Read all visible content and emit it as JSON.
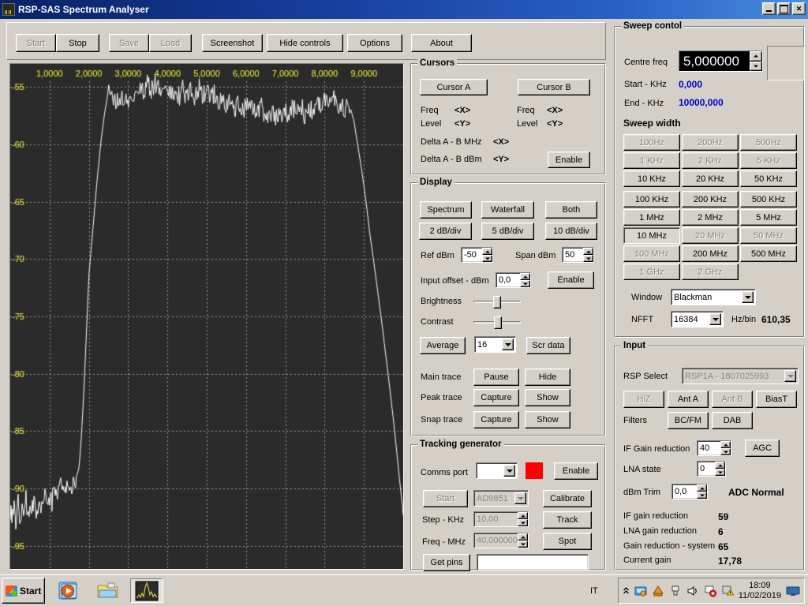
{
  "window": {
    "title": "RSP-SAS Spectrum Analyser",
    "icon": "spectrum-app-icon",
    "buttons": {
      "minimize": "_",
      "maximize": "□",
      "close": "✕"
    }
  },
  "toolbar": {
    "buttons": [
      {
        "label": "Start",
        "disabled": true,
        "name": "start-button"
      },
      {
        "label": "Stop",
        "disabled": false,
        "name": "stop-button"
      },
      {
        "label": "Save",
        "disabled": true,
        "name": "save-button"
      },
      {
        "label": "Load",
        "disabled": true,
        "name": "load-button"
      },
      {
        "label": "Screenshot",
        "disabled": false,
        "name": "screenshot-button"
      },
      {
        "label": "Hide controls",
        "disabled": false,
        "name": "hide-controls-button"
      },
      {
        "label": "Options",
        "disabled": false,
        "name": "options-button"
      },
      {
        "label": "About",
        "disabled": false,
        "name": "about-button"
      }
    ]
  },
  "cursors": {
    "legend": "Cursors",
    "cursor_a_button": "Cursor A",
    "cursor_b_button": "Cursor B",
    "a_freq_label": "Freq",
    "a_freq_value": "<X>",
    "a_level_label": "Level",
    "a_level_value": "<Y>",
    "b_freq_label": "Freq",
    "b_freq_value": "<X>",
    "b_level_label": "Level",
    "b_level_value": "<Y>",
    "delta_mhz_label": "Delta A - B MHz",
    "delta_mhz_value": "<X>",
    "delta_dbm_label": "Delta A - B dBm",
    "delta_dbm_value": "<Y>",
    "enable_button": "Enable"
  },
  "display": {
    "legend": "Display",
    "mode_buttons": [
      {
        "label": "Spectrum",
        "name": "spectrum-mode-button"
      },
      {
        "label": "Waterfall",
        "name": "waterfall-mode-button"
      },
      {
        "label": "Both",
        "name": "both-mode-button"
      }
    ],
    "scale_buttons": [
      {
        "label": "2 dB/div",
        "name": "scale-2db-button"
      },
      {
        "label": "5 dB/div",
        "name": "scale-5db-button"
      },
      {
        "label": "10 dB/div",
        "name": "scale-10db-button"
      }
    ],
    "ref_dbm_label": "Ref dBm",
    "ref_dbm_value": "-50",
    "span_dbm_label": "Span dBm",
    "span_dbm_value": "50",
    "input_offset_label": "Input offset - dBm",
    "input_offset_value": "0,0",
    "input_offset_enable": "Enable",
    "brightness_label": "Brightness",
    "contrast_label": "Contrast",
    "average_button": "Average",
    "average_value": "16",
    "scr_data_button": "Scr data",
    "main_trace_label": "Main trace",
    "main_trace_pause": "Pause",
    "main_trace_hide": "Hide",
    "peak_trace_label": "Peak trace",
    "peak_trace_capture": "Capture",
    "peak_trace_show": "Show",
    "snap_trace_label": "Snap trace",
    "snap_trace_capture": "Capture",
    "snap_trace_show": "Show"
  },
  "tracking_generator": {
    "legend": "Tracking generator",
    "comms_port_label": "Comms port",
    "comms_port_value": "",
    "status_color": "#ff0000",
    "enable_button": "Enable",
    "start_button": "Start",
    "chip_value": "AD9851",
    "calibrate_button": "Calibrate",
    "step_khz_label": "Step - KHz",
    "step_khz_value": "10,00",
    "track_button": "Track",
    "freq_mhz_label": "Freq - MHz",
    "freq_mhz_value": "40,000000",
    "spot_button": "Spot",
    "get_pins_button": "Get pins",
    "get_pins_value": ""
  },
  "sweep_control": {
    "legend": "Sweep contol",
    "centre_freq_label": "Centre freq",
    "centre_freq_value": "5,000000",
    "start_khz_label": "Start - KHz",
    "start_khz_value": "0,000",
    "end_khz_label": "End - KHz",
    "end_khz_value": "10000,000",
    "sweep_width_label": "Sweep width",
    "sweep_width_buttons": [
      {
        "label": "100Hz",
        "disabled": true,
        "selected": false
      },
      {
        "label": "200Hz",
        "disabled": true,
        "selected": false
      },
      {
        "label": "500Hz",
        "disabled": true,
        "selected": false
      },
      {
        "label": "1 KHz",
        "disabled": true,
        "selected": false
      },
      {
        "label": "2 KHz",
        "disabled": true,
        "selected": false
      },
      {
        "label": "5 KHz",
        "disabled": true,
        "selected": false
      },
      {
        "label": "10 KHz",
        "disabled": false,
        "selected": false
      },
      {
        "label": "20 KHz",
        "disabled": false,
        "selected": false
      },
      {
        "label": "50 KHz",
        "disabled": false,
        "selected": false
      },
      {
        "label": "100 KHz",
        "disabled": false,
        "selected": false
      },
      {
        "label": "200 KHz",
        "disabled": false,
        "selected": false
      },
      {
        "label": "500 KHz",
        "disabled": false,
        "selected": false
      },
      {
        "label": "1 MHz",
        "disabled": false,
        "selected": false
      },
      {
        "label": "2 MHz",
        "disabled": false,
        "selected": false
      },
      {
        "label": "5 MHz",
        "disabled": false,
        "selected": false
      },
      {
        "label": "10 MHz",
        "disabled": false,
        "selected": true
      },
      {
        "label": "20 MHz",
        "disabled": true,
        "selected": false
      },
      {
        "label": "50 MHz",
        "disabled": true,
        "selected": false
      },
      {
        "label": "100 MHz",
        "disabled": true,
        "selected": false
      },
      {
        "label": "200 MHz",
        "disabled": false,
        "selected": false
      },
      {
        "label": "500 MHz",
        "disabled": false,
        "selected": false
      },
      {
        "label": "1 GHz",
        "disabled": true,
        "selected": false
      },
      {
        "label": "2 GHz",
        "disabled": true,
        "selected": false
      }
    ],
    "window_label": "Window",
    "window_value": "Blackman",
    "nfft_label": "NFFT",
    "nfft_value": "16384",
    "hz_bin_label": "Hz/bin",
    "hz_bin_value": "610,35"
  },
  "input": {
    "legend": "Input",
    "rsp_select_label": "RSP Select",
    "rsp_select_value": "RSP1A - 1807025993",
    "ant_buttons": [
      {
        "label": "HiZ",
        "disabled": true,
        "selected": false
      },
      {
        "label": "Ant A",
        "disabled": false,
        "selected": true
      },
      {
        "label": "Ant B",
        "disabled": true,
        "selected": false
      },
      {
        "label": "BiasT",
        "disabled": false,
        "selected": false
      }
    ],
    "filters_label": "Filters",
    "filter_buttons": [
      {
        "label": "BC/FM",
        "name": "filter-bcfm-button"
      },
      {
        "label": "DAB",
        "name": "filter-dab-button"
      }
    ],
    "if_gain_reduction_label": "IF Gain reduction",
    "if_gain_reduction_value": "40",
    "agc_button": "AGC",
    "lna_state_label": "LNA state",
    "lna_state_value": "0",
    "dbm_trim_label": "dBm Trim",
    "dbm_trim_value": "0,0",
    "adc_status": "ADC Normal",
    "readouts": [
      {
        "label": "IF gain reduction",
        "value": "59"
      },
      {
        "label": "LNA gain reduction",
        "value": "6"
      },
      {
        "label": "Gain reduction - system",
        "value": "65"
      },
      {
        "label": "Current gain",
        "value": "17,78"
      }
    ]
  },
  "taskbar": {
    "start_label": "Start",
    "items": [
      {
        "name": "taskbar-media-player-icon",
        "active": false
      },
      {
        "name": "taskbar-explorer-icon",
        "active": false
      },
      {
        "name": "taskbar-spectrum-icon",
        "active": true
      }
    ],
    "language": "IT",
    "tray_icons": [
      "show-hidden-icons-chevron",
      "network-tray-icon",
      "update-tray-icon",
      "usb-tray-icon",
      "volume-tray-icon",
      "flag-error-tray-icon",
      "warning-tray-icon"
    ],
    "time": "18:09",
    "date": "11/02/2019",
    "show-desktop": "show-desktop-icon"
  },
  "chart_data": {
    "type": "line",
    "title": "",
    "xlabel": "",
    "ylabel": "",
    "xtick_labels": [
      "1,0000",
      "2,0000",
      "3,0000",
      "4,0000",
      "5,0000",
      "6,0000",
      "7,0000",
      "8,0000",
      "9,0000"
    ],
    "ytick_labels": [
      "-55",
      "-60",
      "-65",
      "-70",
      "-75",
      "-80",
      "-85",
      "-90",
      "-95"
    ],
    "xlim": [
      0.0,
      10.0
    ],
    "ylim": [
      -97.0,
      -53.0
    ],
    "grid": true,
    "trace_color": "#ffffff",
    "background": "#2b2b2b",
    "grid_color": "#9a9a8c",
    "tick_color": "#f2f23c",
    "x_unit": "MHz",
    "y_unit": "dBm",
    "noise_floor_dbm": -91.5,
    "passband_level_dbm": -56.3,
    "passband_start_mhz": 1.72,
    "passband_end_mhz": 8.73,
    "series": [
      {
        "name": "Main trace",
        "x": [
          0.0,
          0.05,
          0.1,
          0.15,
          0.2,
          0.25,
          0.3,
          0.35,
          0.4,
          0.45,
          0.5,
          0.55,
          0.6,
          0.65,
          0.7,
          0.75,
          0.8,
          0.85,
          0.9,
          0.95,
          1.0,
          1.05,
          1.1,
          1.15,
          1.2,
          1.25,
          1.3,
          1.35,
          1.4,
          1.45,
          1.5,
          1.55,
          1.6,
          1.65,
          1.7,
          1.75,
          1.8,
          1.85,
          1.9,
          1.95,
          2.0,
          2.1,
          2.2,
          2.3,
          2.4,
          2.5,
          2.6,
          2.7,
          2.8,
          2.9,
          3.0,
          3.1,
          3.2,
          3.3,
          3.4,
          3.5,
          3.6,
          3.7,
          3.8,
          3.9,
          4.0,
          4.1,
          4.2,
          4.3,
          4.4,
          4.5,
          4.6,
          4.7,
          4.8,
          4.9,
          5.0,
          5.1,
          5.2,
          5.3,
          5.4,
          5.5,
          5.6,
          5.7,
          5.8,
          5.9,
          6.0,
          6.1,
          6.2,
          6.3,
          6.4,
          6.5,
          6.6,
          6.7,
          6.8,
          6.9,
          7.0,
          7.1,
          7.2,
          7.3,
          7.4,
          7.5,
          7.6,
          7.7,
          7.8,
          7.9,
          8.0,
          8.1,
          8.2,
          8.3,
          8.4,
          8.5,
          8.6,
          8.7,
          8.75,
          8.8,
          8.85,
          8.9,
          8.95,
          9.0,
          9.05,
          9.1,
          9.15,
          9.2,
          9.25,
          9.3,
          9.35,
          9.4,
          9.45,
          9.5,
          9.55,
          9.6,
          9.65,
          9.7,
          9.75,
          9.8,
          9.85,
          9.9,
          9.95,
          10.0
        ],
        "y": [
          -91.8,
          -92.5,
          -91.6,
          -92.8,
          -91.4,
          -92.9,
          -91.3,
          -92.4,
          -91.0,
          -92.6,
          -91.5,
          -92.2,
          -90.9,
          -92.0,
          -91.2,
          -92.3,
          -90.8,
          -91.8,
          -90.6,
          -91.5,
          -90.4,
          -91.2,
          -90.2,
          -91.0,
          -90.0,
          -90.8,
          -89.8,
          -90.5,
          -89.6,
          -90.2,
          -89.4,
          -89.9,
          -89.2,
          -89.6,
          -88.8,
          -88.2,
          -86.0,
          -83.0,
          -79.5,
          -75.5,
          -71.5,
          -67.5,
          -63.5,
          -60.0,
          -57.3,
          -55.3,
          -55.9,
          -56.5,
          -55.7,
          -56.6,
          -55.9,
          -56.8,
          -55.4,
          -54.9,
          -55.6,
          -54.7,
          -55.4,
          -54.6,
          -55.2,
          -55.8,
          -54.9,
          -55.6,
          -55.1,
          -55.9,
          -55.3,
          -56.0,
          -55.2,
          -55.8,
          -54.9,
          -55.7,
          -55.3,
          -56.2,
          -55.5,
          -56.3,
          -55.8,
          -56.6,
          -56.0,
          -56.8,
          -56.3,
          -57.0,
          -56.5,
          -57.2,
          -56.7,
          -57.4,
          -56.9,
          -57.6,
          -57.0,
          -57.7,
          -57.1,
          -57.8,
          -57.0,
          -57.6,
          -56.8,
          -57.5,
          -56.7,
          -57.3,
          -56.5,
          -57.2,
          -56.3,
          -57.0,
          -56.2,
          -56.9,
          -55.6,
          -56.6,
          -56.2,
          -56.9,
          -56.6,
          -57.4,
          -58.0,
          -59.2,
          -60.2,
          -61.3,
          -62.4,
          -63.6,
          -64.9,
          -66.3,
          -67.8,
          -69.0,
          -70.2,
          -71.5,
          -72.8,
          -74.1,
          -75.4,
          -76.8,
          -78.2,
          -79.6,
          -81.0,
          -82.5,
          -84.0,
          -85.6,
          -87.3,
          -89.0,
          -90.6,
          -92.0,
          -92.8,
          -92.3
        ]
      }
    ]
  }
}
